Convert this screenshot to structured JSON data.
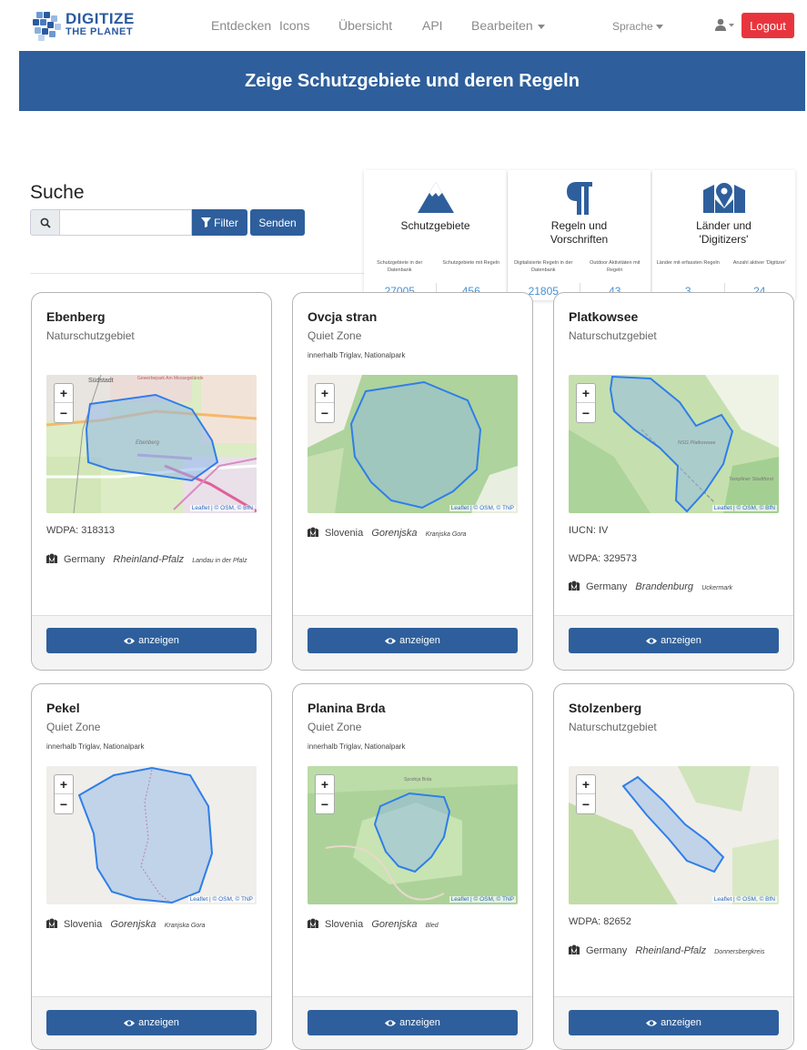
{
  "nav": {
    "logo_line1": "DIGITIZE",
    "logo_line2": "THE PLANET",
    "links": [
      "Entdecken",
      "Icons",
      "Übersicht",
      "API",
      "Bearbeiten"
    ],
    "language": "Sprache",
    "logout": "Logout"
  },
  "banner": {
    "title": "Zeige Schutzgebiete und deren Regeln"
  },
  "search": {
    "title": "Suche",
    "value": "",
    "filter_label": "Filter",
    "send_label": "Senden"
  },
  "stats": [
    {
      "icon": "mountain-icon",
      "title": "Schutzgebiete",
      "labels": [
        "Schutzgebiete in der Datenbank",
        "Schutzgebiete mit Regeln"
      ],
      "values": [
        "27005",
        "456"
      ]
    },
    {
      "icon": "paragraph-icon",
      "title": "Regeln und Vorschriften",
      "labels": [
        "Digitalisierte Regeln in der Datenbank",
        "Outdoor Aktivitäten mit Regeln"
      ],
      "values": [
        "21805",
        "43"
      ]
    },
    {
      "icon": "map-marker-icon",
      "title": "Länder und 'Digitizers'",
      "labels": [
        "Länder mit erfassten Regeln",
        "Anzahl aktiver 'Digitizer'"
      ],
      "values": [
        "3",
        "24"
      ]
    }
  ],
  "cards": [
    {
      "name": "Ebenberg",
      "type": "Naturschutzgebiet",
      "within": "",
      "attribution": "Leaflet | © OSM, © BfN",
      "map_labels": [
        "Südstadt",
        "Gewerbepark Am Messegelände",
        "Ebenberg"
      ],
      "info": [
        "WDPA: 318313"
      ],
      "country": "Germany",
      "region": "Rheinland-Pfalz",
      "district": "Landau in der Pfalz",
      "button": "anzeigen"
    },
    {
      "name": "Ovcja stran",
      "type": "Quiet Zone",
      "within": "innerhalb Triglav, Nationalpark",
      "attribution": "Leaflet | © OSM, © TNP",
      "map_labels": [],
      "info": [],
      "country": "Slovenia",
      "region": "Gorenjska",
      "district": "Kranjska Gora",
      "button": "anzeigen"
    },
    {
      "name": "Platkowsee",
      "type": "Naturschutzgebiet",
      "within": "",
      "attribution": "Leaflet | © OSM, © BfN",
      "map_labels": [
        "NSG Platkowsee",
        "Templiner Stadtforst"
      ],
      "info": [
        "IUCN: IV",
        "WDPA: 329573"
      ],
      "country": "Germany",
      "region": "Brandenburg",
      "district": "Uckermark",
      "button": "anzeigen"
    },
    {
      "name": "Pekel",
      "type": "Quiet Zone",
      "within": "innerhalb Triglav, Nationalpark",
      "attribution": "Leaflet | © OSM, © TNP",
      "map_labels": [],
      "info": [],
      "country": "Slovenia",
      "region": "Gorenjska",
      "district": "Kranjska Gora",
      "button": "anzeigen"
    },
    {
      "name": "Planina Brda",
      "type": "Quiet Zone",
      "within": "innerhalb Triglav, Nationalpark",
      "attribution": "Leaflet | © OSM, © TNP",
      "map_labels": [
        "Spodnja Brda"
      ],
      "info": [],
      "country": "Slovenia",
      "region": "Gorenjska",
      "district": "Bled",
      "button": "anzeigen"
    },
    {
      "name": "Stolzenberg",
      "type": "Naturschutzgebiet",
      "within": "",
      "attribution": "Leaflet | © OSM, © BfN",
      "map_labels": [],
      "info": [
        "WDPA: 82652"
      ],
      "country": "Germany",
      "region": "Rheinland-Pfalz",
      "district": "Donnersbergkreis",
      "button": "anzeigen"
    }
  ],
  "colors": {
    "primary": "#2e5f9c",
    "logout": "#e8353d",
    "stat_value": "#4a90d0",
    "polygon_stroke": "#2f7ee8",
    "polygon_fill": "#8fb8e8"
  }
}
